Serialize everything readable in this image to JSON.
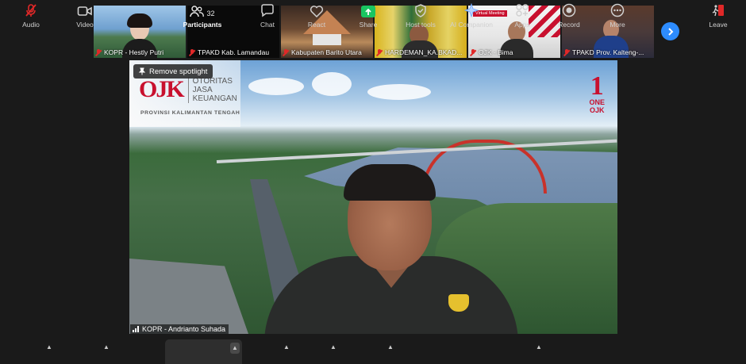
{
  "thumbnails": [
    {
      "label": "KOPR - Hestly Putri"
    },
    {
      "label": "TPAKD Kab. Lamandau"
    },
    {
      "label": "Kabupaten Barito Utara"
    },
    {
      "label": "HARDEMAN_KA.BKAD..."
    },
    {
      "label": "OJK - Bima",
      "overlay": "Virtual Meeting"
    },
    {
      "label": "TPAKD Prov. Kalteng-..."
    }
  ],
  "main_video": {
    "spotlight_button": "Remove spotlight",
    "speaker_name": "KOPR - Andrianto Suhada",
    "logo": {
      "mark": "OJK",
      "line1": "OTORITAS",
      "line2": "JASA",
      "line3": "KEUANGAN",
      "province": "PROVINSI KALIMANTAN TENGAH"
    },
    "one_ojk": {
      "number": "1",
      "line1": "ONE",
      "line2": "OJK"
    }
  },
  "toolbar": {
    "audio": "Audio",
    "video": "Video",
    "participants": "Participants",
    "participants_count": "32",
    "chat": "Chat",
    "react": "React",
    "share": "Share",
    "host_tools": "Host tools",
    "ai_companion": "AI Companion",
    "apps": "Apps",
    "record": "Record",
    "more": "More",
    "leave": "Leave"
  },
  "colors": {
    "accent": "#2d8cff",
    "share": "#19c561",
    "mic_muted": "#e02828",
    "leave": "#e02828",
    "brand": "#c8102e"
  }
}
